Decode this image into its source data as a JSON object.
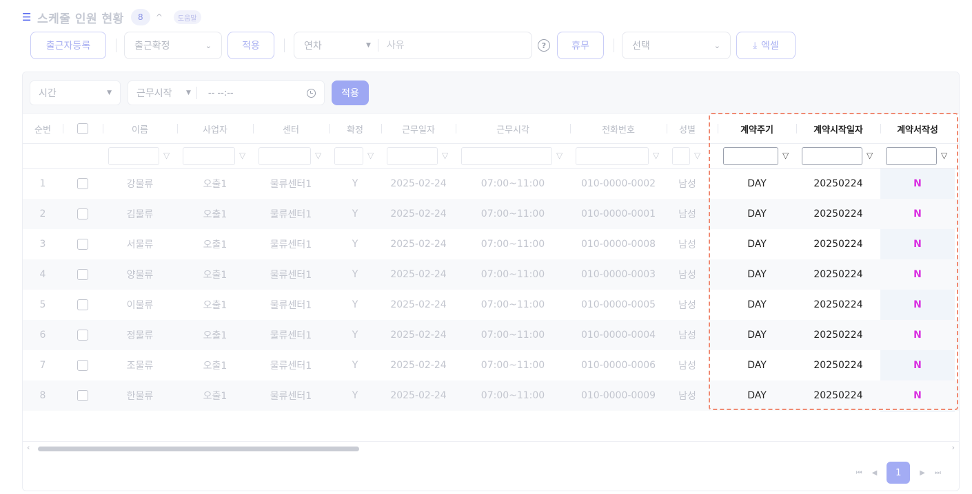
{
  "title": {
    "icon": "list-icon",
    "text": "스케줄 인원 현황",
    "count": "8",
    "caret": "^",
    "help": "도움말"
  },
  "toolbar": {
    "register_label": "출근자등록",
    "confirm_select": "출근확정",
    "apply_label": "적용",
    "leave_type_select": "연차",
    "reason_placeholder": "사유",
    "rest_label": "휴무",
    "choice_select": "선택",
    "excel_label": "엑셀"
  },
  "filterbar": {
    "time_select": "시간",
    "work_start_select": "근무시작",
    "time_input": "-- --:--",
    "apply_label": "적용"
  },
  "table": {
    "headers": {
      "seq": "순번",
      "name": "이름",
      "business": "사업자",
      "center": "센터",
      "confirm": "확정",
      "work_date": "근무일자",
      "work_time": "근무시각",
      "phone": "전화번호",
      "gender": "성별",
      "contract_cycle": "계약주기",
      "contract_start": "계약시작일자",
      "contract_written": "계약서작성"
    },
    "rows": [
      {
        "seq": "1",
        "name": "강물류",
        "business": "오출1",
        "center": "물류센터1",
        "confirm": "Y",
        "work_date": "2025-02-24",
        "work_time": "07:00~11:00",
        "phone": "010-0000-0002",
        "gender": "남성",
        "contract_cycle": "DAY",
        "contract_start": "20250224",
        "contract_written": "N"
      },
      {
        "seq": "2",
        "name": "김물류",
        "business": "오출1",
        "center": "물류센터1",
        "confirm": "Y",
        "work_date": "2025-02-24",
        "work_time": "07:00~11:00",
        "phone": "010-0000-0001",
        "gender": "남성",
        "contract_cycle": "DAY",
        "contract_start": "20250224",
        "contract_written": "N"
      },
      {
        "seq": "3",
        "name": "서물류",
        "business": "오출1",
        "center": "물류센터1",
        "confirm": "Y",
        "work_date": "2025-02-24",
        "work_time": "07:00~11:00",
        "phone": "010-0000-0008",
        "gender": "남성",
        "contract_cycle": "DAY",
        "contract_start": "20250224",
        "contract_written": "N"
      },
      {
        "seq": "4",
        "name": "양물류",
        "business": "오출1",
        "center": "물류센터1",
        "confirm": "Y",
        "work_date": "2025-02-24",
        "work_time": "07:00~11:00",
        "phone": "010-0000-0003",
        "gender": "남성",
        "contract_cycle": "DAY",
        "contract_start": "20250224",
        "contract_written": "N"
      },
      {
        "seq": "5",
        "name": "이물류",
        "business": "오출1",
        "center": "물류센터1",
        "confirm": "Y",
        "work_date": "2025-02-24",
        "work_time": "07:00~11:00",
        "phone": "010-0000-0005",
        "gender": "남성",
        "contract_cycle": "DAY",
        "contract_start": "20250224",
        "contract_written": "N"
      },
      {
        "seq": "6",
        "name": "정물류",
        "business": "오출1",
        "center": "물류센터1",
        "confirm": "Y",
        "work_date": "2025-02-24",
        "work_time": "07:00~11:00",
        "phone": "010-0000-0004",
        "gender": "남성",
        "contract_cycle": "DAY",
        "contract_start": "20250224",
        "contract_written": "N"
      },
      {
        "seq": "7",
        "name": "조물류",
        "business": "오출1",
        "center": "물류센터1",
        "confirm": "Y",
        "work_date": "2025-02-24",
        "work_time": "07:00~11:00",
        "phone": "010-0000-0006",
        "gender": "남성",
        "contract_cycle": "DAY",
        "contract_start": "20250224",
        "contract_written": "N"
      },
      {
        "seq": "8",
        "name": "한물류",
        "business": "오출1",
        "center": "물류센터1",
        "confirm": "Y",
        "work_date": "2025-02-24",
        "work_time": "07:00~11:00",
        "phone": "010-0000-0009",
        "gender": "남성",
        "contract_cycle": "DAY",
        "contract_start": "20250224",
        "contract_written": "N"
      }
    ]
  },
  "pagination": {
    "current": "1"
  },
  "colors": {
    "accent": "#a3acf4",
    "flag": "#d92fe0",
    "highlight_border": "#f08a72"
  }
}
